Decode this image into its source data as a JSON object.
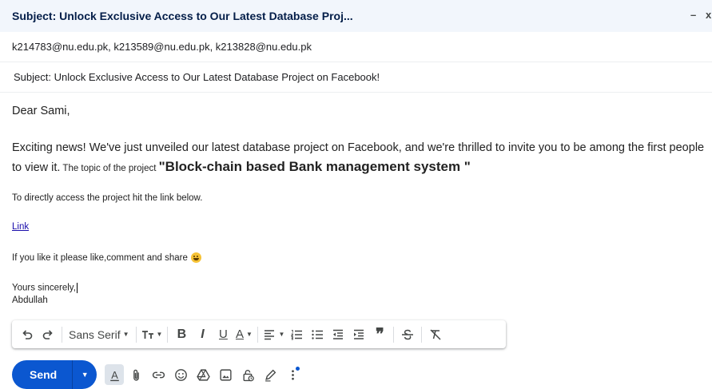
{
  "window": {
    "title": "Subject: Unlock Exclusive Access to Our Latest Database Proj...",
    "minimize_label": "–",
    "close_label": "x"
  },
  "recipients": "k214783@nu.edu.pk, k213589@nu.edu.pk, k213828@nu.edu.pk",
  "subject": "Subject: Unlock Exclusive Access to Our Latest Database Project on Facebook!",
  "body": {
    "greeting": "Dear Sami,",
    "paragraph": "Exciting news! We've just unveiled our latest database project on Facebook, and we're thrilled to invite you to be among the first people to view it.",
    "topic_lead": " The topic of the project ",
    "topic": " \"Block-chain based  Bank management system \"",
    "access_line": "To directly access the project hit the link below.",
    "link_text": "Link",
    "like_line": "If you like it please like,comment and share",
    "signoff": "Yours sincerely,",
    "signature": "Abdullah"
  },
  "toolbar": {
    "font_name": "Sans Serif",
    "items": [
      "undo-icon",
      "redo-icon",
      "font-family",
      "text-size-icon",
      "bold-icon",
      "italic-icon",
      "underline-icon",
      "text-color-icon",
      "align-icon",
      "numbered-list-icon",
      "bulleted-list-icon",
      "indent-less-icon",
      "indent-more-icon",
      "quote-icon",
      "strikethrough-icon",
      "remove-formatting-icon"
    ]
  },
  "actions": {
    "send_label": "Send",
    "icons": [
      "formatting-options-icon",
      "attach-icon",
      "insert-link-icon",
      "emoji-icon",
      "drive-icon",
      "insert-photo-icon",
      "confidential-mode-icon",
      "signature-icon",
      "more-options-icon"
    ]
  },
  "colors": {
    "accent": "#0b57d0",
    "titlebar_bg": "#f2f6fc",
    "link": "#1a0dab"
  }
}
